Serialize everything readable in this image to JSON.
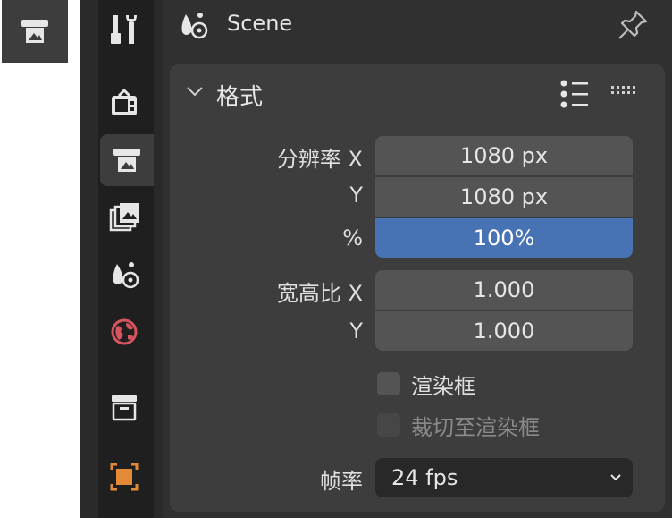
{
  "header": {
    "title": "Scene"
  },
  "panel": {
    "title": "格式",
    "resolution_label_x": "分辨率 X",
    "resolution_label_y": "Y",
    "resolution_label_pct": "%",
    "resolution_x": "1080 px",
    "resolution_y": "1080 px",
    "resolution_pct": "100%",
    "aspect_label_x": "宽高比 X",
    "aspect_label_y": "Y",
    "aspect_x": "1.000",
    "aspect_y": "1.000",
    "render_region_label": "渲染框",
    "crop_label": "裁切至渲染框",
    "framerate_label": "帧率",
    "framerate_value": "24 fps"
  },
  "colors": {
    "accent": "#4772b3",
    "field_bg": "#545454",
    "panel_bg": "#3d3d3d",
    "world_icon": "#d6555f",
    "object_icon": "#e38a36"
  },
  "icons": {
    "tabs": [
      "tool-icon",
      "render-icon",
      "output-icon",
      "view-layer-icon",
      "scene-icon",
      "world-icon",
      "collection-icon",
      "object-icon"
    ]
  }
}
